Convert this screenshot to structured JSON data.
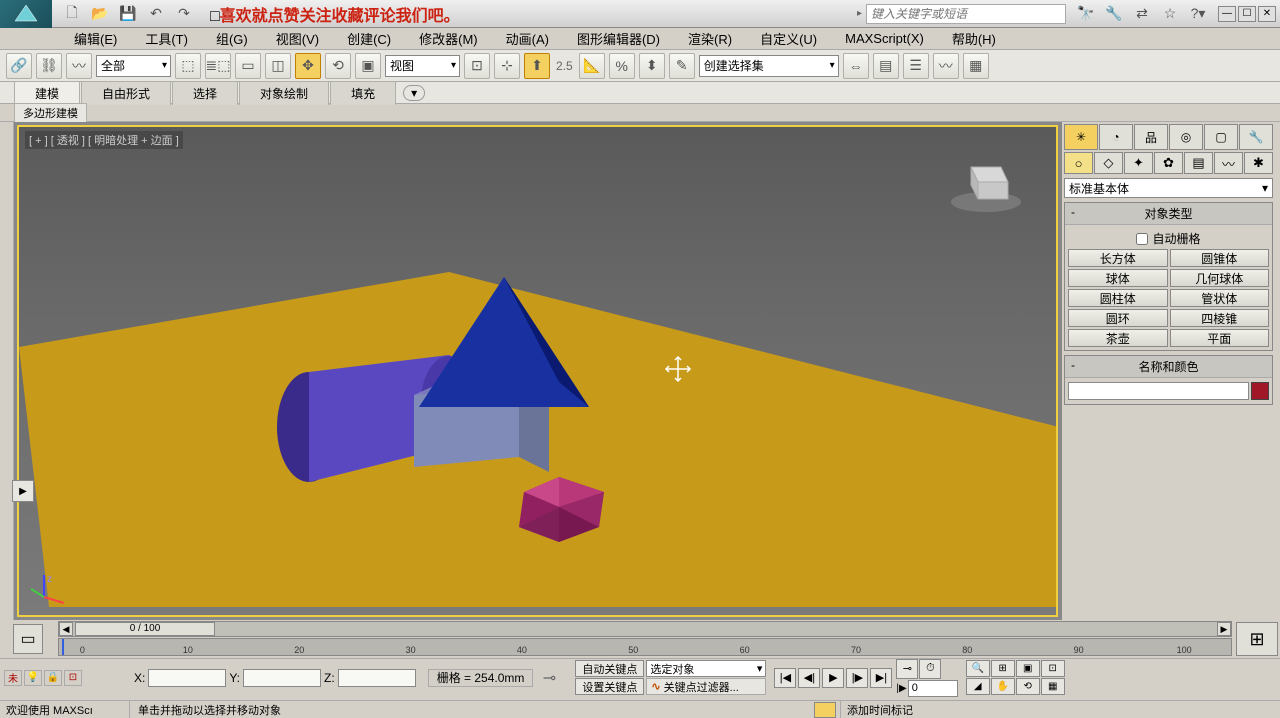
{
  "title": {
    "prefix": "□",
    "text": "喜欢就点赞关注收藏评论我们吧。"
  },
  "search_placeholder": "键入关键字或短语",
  "menus": [
    "编辑(E)",
    "工具(T)",
    "组(G)",
    "视图(V)",
    "创建(C)",
    "修改器(M)",
    "动画(A)",
    "图形编辑器(D)",
    "渲染(R)",
    "自定义(U)",
    "MAXScript(X)",
    "帮助(H)"
  ],
  "toolbar": {
    "sel_filter": "全部",
    "ref_coord": "视图",
    "snap_val": "2.5",
    "named_sel": "创建选择集"
  },
  "ribbon_tabs": [
    "建模",
    "自由形式",
    "选择",
    "对象绘制",
    "填充"
  ],
  "sub_ribbon": "多边形建模",
  "viewport_label": "[ + ] [ 透视 ] [ 明暗处理 + 边面 ]",
  "cmdpanel": {
    "category": "标准基本体",
    "rollout_objtype": "对象类型",
    "autogrid": "自动栅格",
    "objects": [
      "长方体",
      "圆锥体",
      "球体",
      "几何球体",
      "圆柱体",
      "管状体",
      "圆环",
      "四棱锥",
      "茶壶",
      "平面"
    ],
    "rollout_name": "名称和颜色",
    "name_value": "",
    "color": "#a01828"
  },
  "timeline": {
    "thumb": "0 / 100",
    "ticks": [
      0,
      10,
      20,
      30,
      40,
      50,
      60,
      70,
      80,
      90,
      100
    ]
  },
  "status": {
    "mini1": "未",
    "x": "X:",
    "y": "Y:",
    "z": "Z:",
    "x_val": "",
    "y_val": "",
    "z_val": "",
    "grid": "栅格 = 254.0mm",
    "autokey": "自动关键点",
    "setkey": "设置关键点",
    "selected": "选定对象",
    "keyfilter": "关键点过滤器...",
    "frame": "0",
    "welcome": "欢迎使用  MAXScı",
    "prompt": "单击并拖动以选择并移动对象",
    "addtag": "添加时间标记"
  }
}
